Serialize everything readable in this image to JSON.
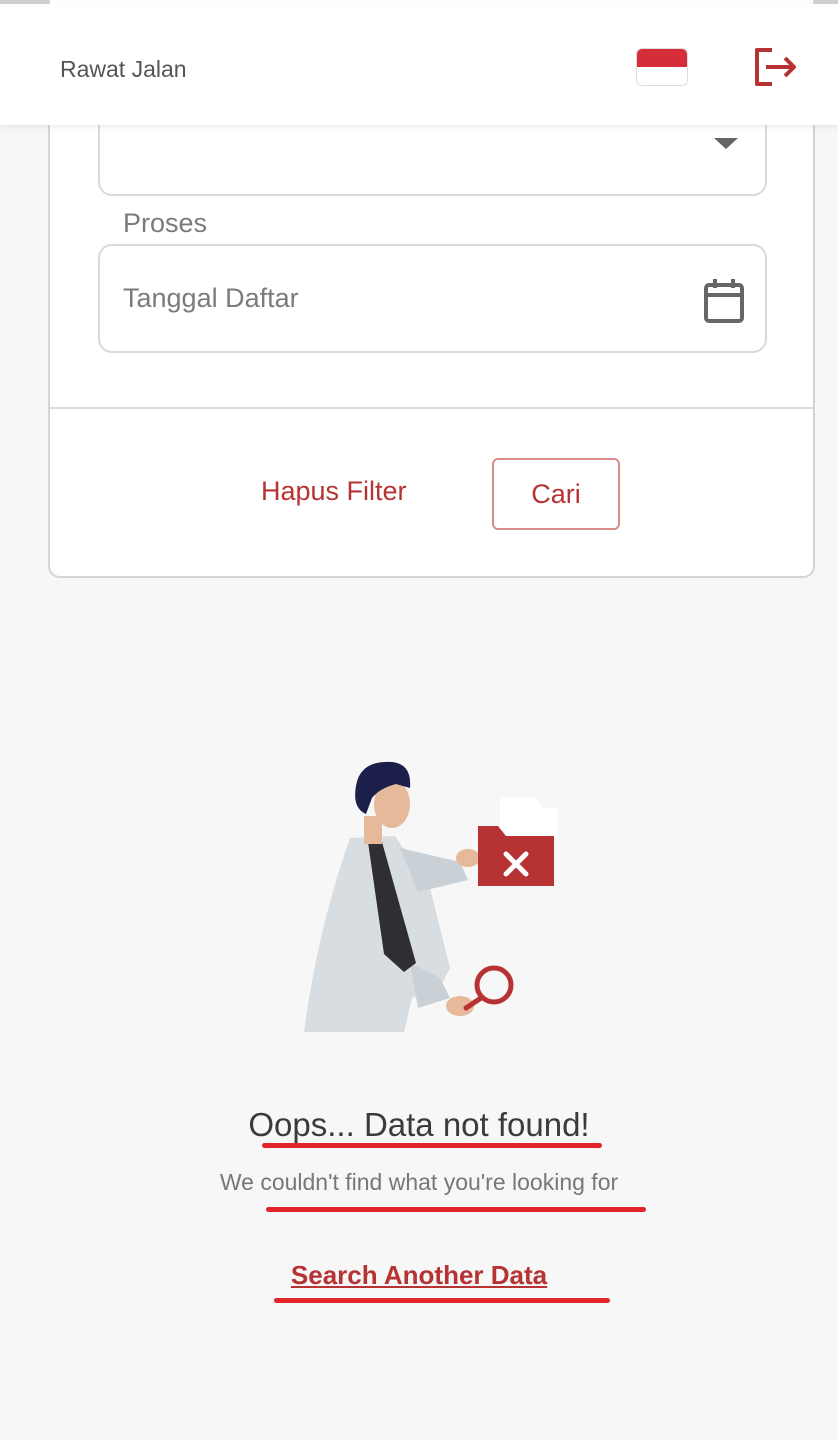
{
  "header": {
    "title": "Rawat Jalan",
    "language_flag": "indonesia-flag",
    "logout_icon": "logout-icon"
  },
  "filter": {
    "status_value": "Proses",
    "date_placeholder": "Tanggal Daftar",
    "clear_label": "Hapus Filter",
    "search_label": "Cari"
  },
  "empty_state": {
    "title": "Oops... Data not found!",
    "subtitle": "We couldn't find what you're looking for",
    "action_label": "Search Another Data"
  },
  "colors": {
    "accent": "#b73232",
    "annotation": "#e3242b"
  }
}
